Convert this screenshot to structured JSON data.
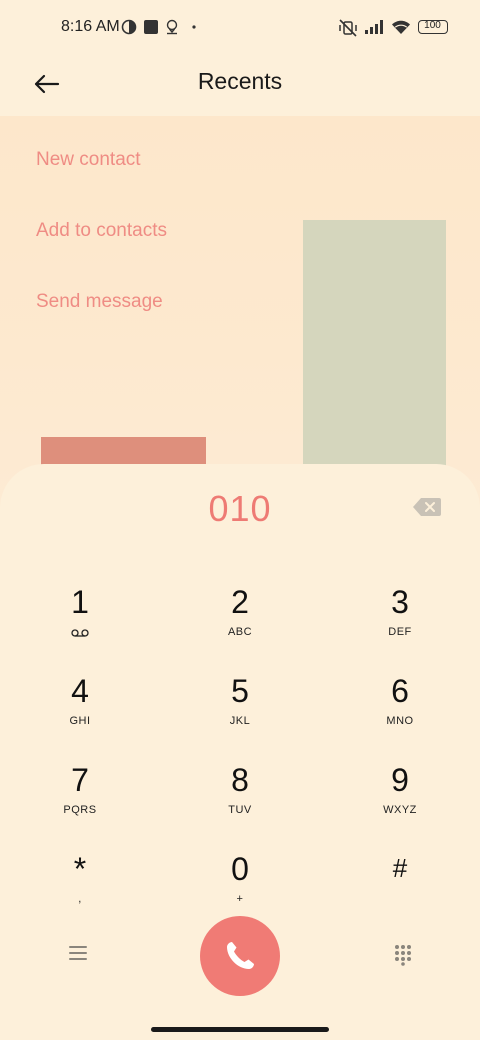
{
  "status_bar": {
    "time": "8:16 AM",
    "battery": "100",
    "icons": [
      "contrast-icon",
      "square-notification-icon",
      "location-pin-icon",
      "dot-icon",
      "vibrate-off-icon",
      "signal-icon",
      "wifi-icon",
      "battery-icon"
    ]
  },
  "header": {
    "title": "Recents",
    "back_icon": "back-arrow-icon"
  },
  "actions": [
    {
      "label": "New contact"
    },
    {
      "label": "Add to contacts"
    },
    {
      "label": "Send message"
    }
  ],
  "dialer": {
    "number": "010",
    "backspace_icon": "backspace-icon",
    "keys": [
      {
        "digit": "1",
        "letters": "",
        "icon": "voicemail-icon"
      },
      {
        "digit": "2",
        "letters": "ABC"
      },
      {
        "digit": "3",
        "letters": "DEF"
      },
      {
        "digit": "4",
        "letters": "GHI"
      },
      {
        "digit": "5",
        "letters": "JKL"
      },
      {
        "digit": "6",
        "letters": "MNO"
      },
      {
        "digit": "7",
        "letters": "PQRS"
      },
      {
        "digit": "8",
        "letters": "TUV"
      },
      {
        "digit": "9",
        "letters": "WXYZ"
      },
      {
        "digit": "*",
        "letters": ","
      },
      {
        "digit": "0",
        "letters": "+"
      },
      {
        "digit": "#",
        "letters": ""
      }
    ]
  },
  "bottom_bar": {
    "menu_icon": "menu-icon",
    "call_icon": "phone-icon",
    "dialpad_icon": "dialpad-icon"
  },
  "colors": {
    "background": "#fdf0da",
    "accent": "#ee7b74",
    "link": "#ef8c84",
    "call_button": "#f07b75"
  }
}
